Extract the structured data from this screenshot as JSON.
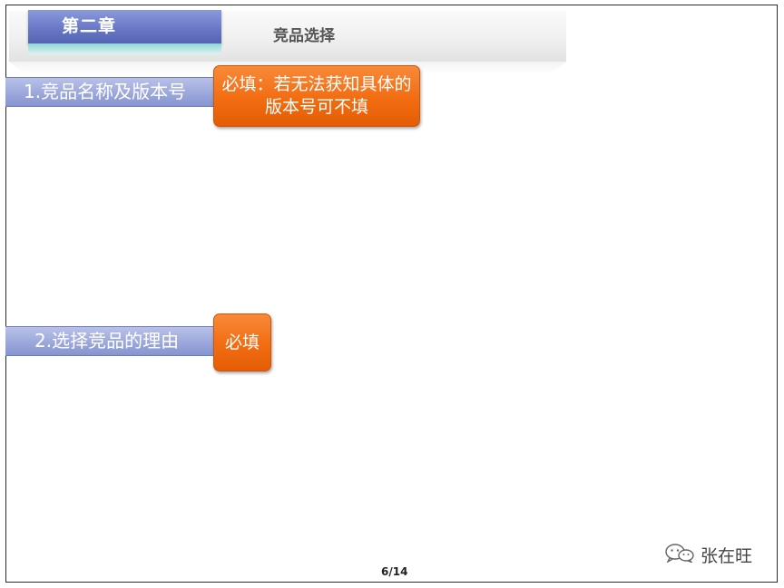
{
  "chapter": "第二章",
  "title": "竞品选择",
  "sections": [
    {
      "label": "1.竞品名称及版本号",
      "note": "必填：若无法获知具体的版本号可不填"
    },
    {
      "label": "2.选择竞品的理由",
      "note": "必填"
    }
  ],
  "page_number": "6/14",
  "watermark": {
    "icon": "wechat-icon",
    "text": "张在旺"
  },
  "colors": {
    "chapter_tab": "#6676c4",
    "section_bar": "#8694d0",
    "note_box": "#f26c11"
  }
}
